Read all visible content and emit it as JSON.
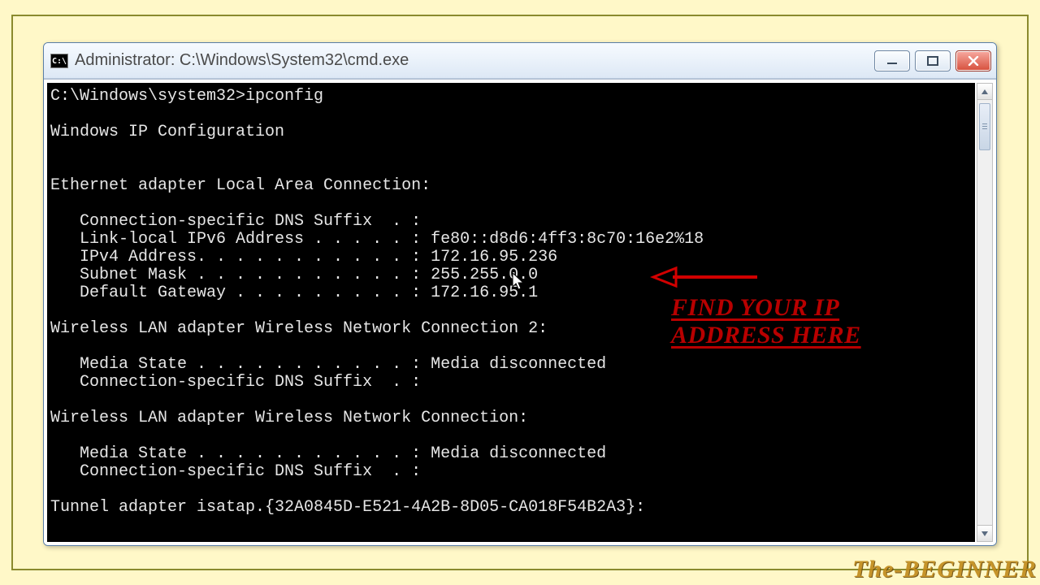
{
  "window": {
    "icon_text": "C:\\",
    "title": "Administrator: C:\\Windows\\System32\\cmd.exe"
  },
  "console": {
    "prompt": "C:\\Windows\\system32>",
    "command": "ipconfig",
    "header": "Windows IP Configuration",
    "adapter1_title": "Ethernet adapter Local Area Connection:",
    "adapter1_line1": "   Connection-specific DNS Suffix  . :",
    "adapter1_line2": "   Link-local IPv6 Address . . . . . : fe80::d8d6:4ff3:8c70:16e2%18",
    "adapter1_line3": "   IPv4 Address. . . . . . . . . . . : 172.16.95.236",
    "adapter1_line4": "   Subnet Mask . . . . . . . . . . . : 255.255.0.0",
    "adapter1_line5": "   Default Gateway . . . . . . . . . : 172.16.95.1",
    "adapter2_title": "Wireless LAN adapter Wireless Network Connection 2:",
    "adapter2_line1": "   Media State . . . . . . . . . . . : Media disconnected",
    "adapter2_line2": "   Connection-specific DNS Suffix  . :",
    "adapter3_title": "Wireless LAN adapter Wireless Network Connection:",
    "adapter3_line1": "   Media State . . . . . . . . . . . : Media disconnected",
    "adapter3_line2": "   Connection-specific DNS Suffix  . :",
    "adapter4_title": "Tunnel adapter isatap.{32A0845D-E521-4A2B-8D05-CA018F54B2A3}:"
  },
  "annotation": {
    "line1": "FIND  YOUR  IP",
    "line2": "ADDRESS  HERE"
  },
  "watermark": "The-BEGINNER"
}
